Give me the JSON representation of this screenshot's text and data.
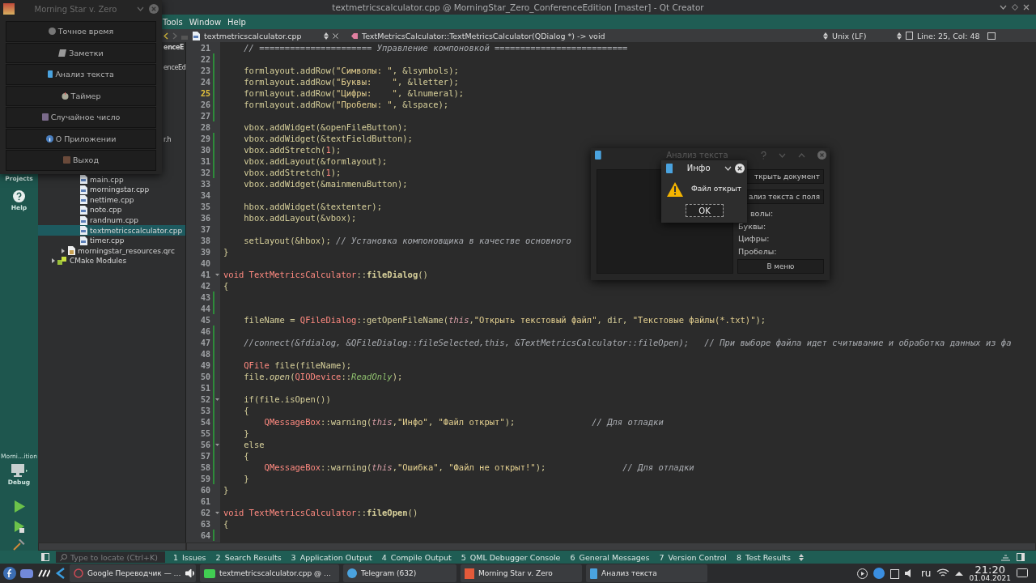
{
  "window": {
    "title": "textmetricscalculator.cpp @ MorningStar_Zero_ConferenceEdition [master] - Qt Creator"
  },
  "menu": [
    "Tools",
    "Window",
    "Help"
  ],
  "editor_toolbar": {
    "file": "textmetricscalculator.cpp",
    "symbol": "TextMetricsCalculator::TextMetricsCalculator(QDialog *) -> void",
    "line_endings": "Unix (LF)",
    "position": "Line: 25, Col: 48"
  },
  "mode_bar": {
    "projects_label": "Projects",
    "help_label": "Help",
    "kit": "Morni…ition",
    "build_type": "Debug"
  },
  "project_tree": {
    "fragments": [
      {
        "label": "enceE",
        "kind": "project"
      },
      {
        "label": "enceEd",
        "kind": "file"
      },
      {
        "label": "r.h",
        "kind": "file"
      }
    ],
    "items": [
      {
        "label": "main.cpp",
        "kind": "source",
        "selected": false
      },
      {
        "label": "morningstar.cpp",
        "kind": "source",
        "selected": false
      },
      {
        "label": "nettime.cpp",
        "kind": "source",
        "selected": false
      },
      {
        "label": "note.cpp",
        "kind": "source",
        "selected": false
      },
      {
        "label": "randnum.cpp",
        "kind": "source",
        "selected": false
      },
      {
        "label": "textmetricscalculator.cpp",
        "kind": "source",
        "selected": true
      },
      {
        "label": "timer.cpp",
        "kind": "source",
        "selected": false
      },
      {
        "label": "morningstar_resources.qrc",
        "kind": "resource",
        "selected": false
      },
      {
        "label": "CMake Modules",
        "kind": "folder",
        "selected": false
      }
    ]
  },
  "code": [
    {
      "number": "21",
      "changed": false,
      "fold": false,
      "current": false,
      "tokens": [
        {
          "kind": "comment",
          "text": "    // ====================== Управление компоновкой =========================="
        }
      ]
    },
    {
      "number": "22",
      "changed": true,
      "fold": false,
      "current": false
    },
    {
      "number": "23",
      "changed": true,
      "fold": false,
      "current": false,
      "tokens": [
        {
          "kind": "plain",
          "text": "    formlayout.addRow("
        },
        {
          "kind": "string",
          "text": "\"Символы: \""
        },
        {
          "kind": "plain",
          "text": ", &lsymbols);"
        }
      ]
    },
    {
      "number": "24",
      "changed": true,
      "fold": false,
      "current": false,
      "tokens": [
        {
          "kind": "plain",
          "text": "    formlayout.addRow("
        },
        {
          "kind": "string",
          "text": "\"Буквы:    \""
        },
        {
          "kind": "plain",
          "text": ", &lletter);"
        }
      ]
    },
    {
      "number": "25",
      "changed": true,
      "fold": false,
      "current": true,
      "tokens": [
        {
          "kind": "plain",
          "text": "    formlayout.addRow("
        },
        {
          "kind": "string",
          "text": "\"Цифры:    \""
        },
        {
          "kind": "plain",
          "text": ", &lnumeral);"
        }
      ]
    },
    {
      "number": "26",
      "changed": true,
      "fold": false,
      "current": false,
      "tokens": [
        {
          "kind": "plain",
          "text": "    formlayout.addRow("
        },
        {
          "kind": "string",
          "text": "\"Пробелы: \""
        },
        {
          "kind": "plain",
          "text": ", &lspace);"
        }
      ]
    },
    {
      "number": "27",
      "changed": true,
      "fold": false,
      "current": false
    },
    {
      "number": "28",
      "changed": false,
      "fold": false,
      "current": false,
      "tokens": [
        {
          "kind": "plain",
          "text": "    vbox.addWidget(&openFileButton);"
        }
      ]
    },
    {
      "number": "29",
      "changed": true,
      "fold": false,
      "current": false,
      "tokens": [
        {
          "kind": "plain",
          "text": "    vbox.addWidget(&textFieldButton);"
        }
      ]
    },
    {
      "number": "30",
      "changed": true,
      "fold": false,
      "current": false,
      "tokens": [
        {
          "kind": "plain",
          "text": "    vbox.addStretch("
        },
        {
          "kind": "number",
          "text": "1"
        },
        {
          "kind": "plain",
          "text": ");"
        }
      ]
    },
    {
      "number": "31",
      "changed": true,
      "fold": false,
      "current": false,
      "tokens": [
        {
          "kind": "plain",
          "text": "    vbox.addLayout(&formlayout);"
        }
      ]
    },
    {
      "number": "32",
      "changed": true,
      "fold": false,
      "current": false,
      "tokens": [
        {
          "kind": "plain",
          "text": "    vbox.addStretch("
        },
        {
          "kind": "number",
          "text": "1"
        },
        {
          "kind": "plain",
          "text": ");"
        }
      ]
    },
    {
      "number": "33",
      "changed": false,
      "fold": false,
      "current": false,
      "tokens": [
        {
          "kind": "plain",
          "text": "    vbox.addWidget(&mainmenuButton);"
        }
      ]
    },
    {
      "number": "34",
      "changed": false,
      "fold": false,
      "current": false
    },
    {
      "number": "35",
      "changed": false,
      "fold": false,
      "current": false,
      "tokens": [
        {
          "kind": "plain",
          "text": "    hbox.addWidget(&textenter);"
        }
      ]
    },
    {
      "number": "36",
      "changed": false,
      "fold": false,
      "current": false,
      "tokens": [
        {
          "kind": "plain",
          "text": "    hbox.addLayout(&vbox);"
        }
      ]
    },
    {
      "number": "37",
      "changed": false,
      "fold": false,
      "current": false
    },
    {
      "number": "38",
      "changed": false,
      "fold": false,
      "current": false,
      "tokens": [
        {
          "kind": "plain",
          "text": "    setLayout(&hbox); "
        },
        {
          "kind": "comment",
          "text": "// Установка компоновщика в качестве основного"
        }
      ]
    },
    {
      "number": "39",
      "changed": false,
      "fold": false,
      "current": false,
      "tokens": [
        {
          "kind": "plain",
          "text": "}"
        }
      ]
    },
    {
      "number": "40",
      "changed": false,
      "fold": false,
      "current": false
    },
    {
      "number": "41",
      "changed": false,
      "fold": true,
      "current": false,
      "tokens": [
        {
          "kind": "keyword",
          "text": "void "
        },
        {
          "kind": "type",
          "text": "TextMetricsCalculator"
        },
        {
          "kind": "plain",
          "text": "::"
        },
        {
          "kind": "function",
          "text": "fileDialog"
        },
        {
          "kind": "plain",
          "text": "()"
        }
      ]
    },
    {
      "number": "42",
      "changed": false,
      "fold": false,
      "current": false,
      "tokens": [
        {
          "kind": "plain",
          "text": "{"
        }
      ]
    },
    {
      "number": "43",
      "changed": true,
      "fold": false,
      "current": false
    },
    {
      "number": "44",
      "changed": true,
      "fold": false,
      "current": false
    },
    {
      "number": "45",
      "changed": false,
      "fold": false,
      "current": false,
      "tokens": [
        {
          "kind": "plain",
          "text": "    fileName = "
        },
        {
          "kind": "type",
          "text": "QFileDialog"
        },
        {
          "kind": "plain",
          "text": "::getOpenFileName("
        },
        {
          "kind": "pointer",
          "text": "this"
        },
        {
          "kind": "plain",
          "text": ","
        },
        {
          "kind": "string",
          "text": "\"Открыть текстовый файл\""
        },
        {
          "kind": "plain",
          "text": ", dir, "
        },
        {
          "kind": "string",
          "text": "\"Текстовые файлы(*.txt)\""
        },
        {
          "kind": "plain",
          "text": ");"
        }
      ]
    },
    {
      "number": "46",
      "changed": true,
      "fold": false,
      "current": false
    },
    {
      "number": "47",
      "changed": true,
      "fold": false,
      "current": false,
      "tokens": [
        {
          "kind": "comment",
          "text": "    //connect(&fdialog, &QFileDialog::fileSelected,this, &TextMetricsCalculator::fileOpen);   // При выборе файла идет считывание и обработка данных из фа"
        }
      ]
    },
    {
      "number": "48",
      "changed": true,
      "fold": false,
      "current": false
    },
    {
      "number": "49",
      "changed": true,
      "fold": false,
      "current": false,
      "tokens": [
        {
          "kind": "type",
          "text": "    QFile"
        },
        {
          "kind": "plain",
          "text": " file(fileName);"
        }
      ]
    },
    {
      "number": "50",
      "changed": true,
      "fold": false,
      "current": false,
      "tokens": [
        {
          "kind": "plain",
          "text": "    file."
        },
        {
          "kind": "method",
          "text": "open"
        },
        {
          "kind": "plain",
          "text": "("
        },
        {
          "kind": "type",
          "text": "QIODevice"
        },
        {
          "kind": "plain",
          "text": "::"
        },
        {
          "kind": "enum",
          "text": "ReadOnly"
        },
        {
          "kind": "plain",
          "text": ");"
        }
      ]
    },
    {
      "number": "51",
      "changed": true,
      "fold": false,
      "current": false
    },
    {
      "number": "52",
      "changed": true,
      "fold": true,
      "current": false,
      "tokens": [
        {
          "kind": "plain",
          "text": "    if(file.isOpen())"
        }
      ]
    },
    {
      "number": "53",
      "changed": true,
      "fold": false,
      "current": false,
      "tokens": [
        {
          "kind": "plain",
          "text": "    {"
        }
      ]
    },
    {
      "number": "54",
      "changed": true,
      "fold": false,
      "current": false,
      "tokens": [
        {
          "kind": "type",
          "text": "        QMessageBox"
        },
        {
          "kind": "plain",
          "text": "::warning("
        },
        {
          "kind": "pointer",
          "text": "this"
        },
        {
          "kind": "plain",
          "text": ","
        },
        {
          "kind": "string",
          "text": "\"Инфо\""
        },
        {
          "kind": "plain",
          "text": ", "
        },
        {
          "kind": "string",
          "text": "\"Файл открыт\""
        },
        {
          "kind": "plain",
          "text": ");               "
        },
        {
          "kind": "comment",
          "text": "// Для отладки"
        }
      ]
    },
    {
      "number": "55",
      "changed": true,
      "fold": false,
      "current": false,
      "tokens": [
        {
          "kind": "plain",
          "text": "    }"
        }
      ]
    },
    {
      "number": "56",
      "changed": true,
      "fold": true,
      "current": false,
      "tokens": [
        {
          "kind": "plain",
          "text": "    else"
        }
      ]
    },
    {
      "number": "57",
      "changed": true,
      "fold": false,
      "current": false,
      "tokens": [
        {
          "kind": "plain",
          "text": "    {"
        }
      ]
    },
    {
      "number": "58",
      "changed": true,
      "fold": false,
      "current": false,
      "tokens": [
        {
          "kind": "type",
          "text": "        QMessageBox"
        },
        {
          "kind": "plain",
          "text": "::warning("
        },
        {
          "kind": "pointer",
          "text": "this"
        },
        {
          "kind": "plain",
          "text": ","
        },
        {
          "kind": "string",
          "text": "\"Ошибка\""
        },
        {
          "kind": "plain",
          "text": ", "
        },
        {
          "kind": "string",
          "text": "\"Файл не открыт!\""
        },
        {
          "kind": "plain",
          "text": ");               "
        },
        {
          "kind": "comment",
          "text": "// Для отладки"
        }
      ]
    },
    {
      "number": "59",
      "changed": true,
      "fold": false,
      "current": false,
      "tokens": [
        {
          "kind": "plain",
          "text": "    }"
        }
      ]
    },
    {
      "number": "60",
      "changed": false,
      "fold": false,
      "current": false,
      "tokens": [
        {
          "kind": "plain",
          "text": "}"
        }
      ]
    },
    {
      "number": "61",
      "changed": false,
      "fold": false,
      "current": false
    },
    {
      "number": "62",
      "changed": false,
      "fold": true,
      "current": false,
      "tokens": [
        {
          "kind": "keyword",
          "text": "void "
        },
        {
          "kind": "type",
          "text": "TextMetricsCalculator"
        },
        {
          "kind": "plain",
          "text": "::"
        },
        {
          "kind": "function",
          "text": "fileOpen"
        },
        {
          "kind": "plain",
          "text": "()"
        }
      ]
    },
    {
      "number": "63",
      "changed": false,
      "fold": false,
      "current": false,
      "tokens": [
        {
          "kind": "plain",
          "text": "{"
        }
      ]
    },
    {
      "number": "64",
      "changed": true,
      "fold": false,
      "current": false
    }
  ],
  "output_bar": {
    "locate_placeholder": "Type to locate (Ctrl+K)",
    "tabs": [
      {
        "number": "1",
        "label": "Issues"
      },
      {
        "number": "2",
        "label": "Search Results"
      },
      {
        "number": "3",
        "label": "Application Output"
      },
      {
        "number": "4",
        "label": "Compile Output"
      },
      {
        "number": "5",
        "label": "QML Debugger Console"
      },
      {
        "number": "6",
        "label": "General Messages"
      },
      {
        "number": "7",
        "label": "Version Control"
      },
      {
        "number": "8",
        "label": "Test Results"
      }
    ]
  },
  "taskbar": {
    "tasks": [
      {
        "label": "Google Переводчик — …"
      },
      {
        "label": "textmetricscalculator.cpp @ …"
      },
      {
        "label": "Telegram (632)"
      },
      {
        "label": "Morning Star v. Zero"
      },
      {
        "label": "Анализ текста"
      }
    ],
    "language": "ru",
    "time": "21:20",
    "date": "01.04.2021"
  },
  "morning_star_window": {
    "title": "Morning Star v. Zero",
    "buttons": [
      "Точное время",
      "Заметки",
      "Анализ текста",
      "Таймер",
      "Случайное число",
      "О Приложении",
      "Выход"
    ]
  },
  "text_analysis_dialog": {
    "title": "Анализ текста",
    "buttons": [
      "ткрыть документ",
      "ализ текста с поля"
    ],
    "labels": [
      "волы:",
      "Буквы:",
      "Цифры:",
      "Пробелы:"
    ],
    "menu_button": "В меню"
  },
  "info_box": {
    "title": "Инфо",
    "message": "Файл открыт",
    "button": "OK"
  }
}
